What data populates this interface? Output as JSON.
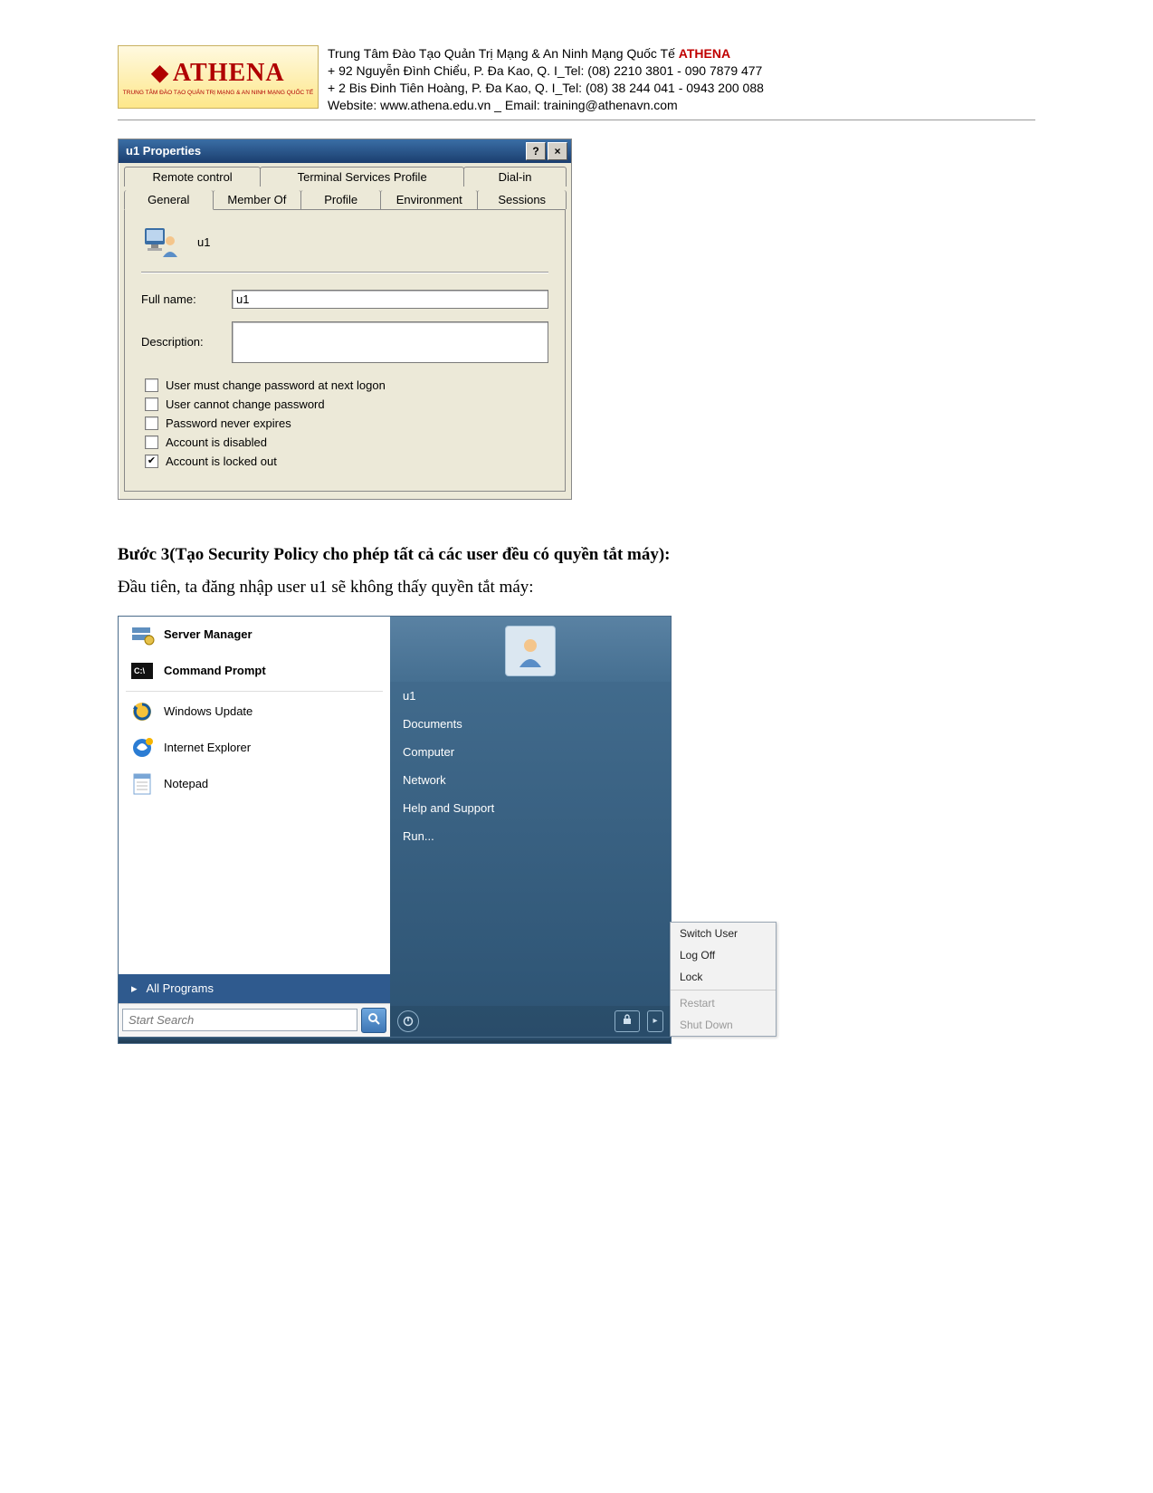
{
  "banner": {
    "logo_text": "ATHENA",
    "logo_sub": "TRUNG TÂM ĐÀO TẠO QUẢN TRỊ MẠNG & AN NINH MẠNG QUỐC TẾ",
    "line1_prefix": "Trung Tâm Đào Tạo Quản Trị Mạng & An Ninh Mạng Quốc Tế ",
    "line1_brand": "ATHENA",
    "line2": "+  92 Nguyễn Đình Chiểu, P. Đa Kao, Q. I_Tel: (08) 2210 3801 -  090 7879 477",
    "line3": "+  2 Bis Đinh Tiên Hoàng, P. Đa Kao, Q. I_Tel: (08) 38 244 041 - 0943 200 088",
    "line4": "Website:  www.athena.edu.vn     _      Email: training@athenavn.com"
  },
  "dialog": {
    "title": "u1 Properties",
    "help": "?",
    "close": "×",
    "tabs_row1": [
      "Remote control",
      "Terminal Services Profile",
      "Dial-in"
    ],
    "tabs_row2": [
      "General",
      "Member Of",
      "Profile",
      "Environment",
      "Sessions"
    ],
    "active_tab": "General",
    "username": "u1",
    "full_name_label": "Full name:",
    "full_name_value": "u1",
    "description_label": "Description:",
    "description_value": "",
    "checks": [
      {
        "label": "User must change password at next logon",
        "checked": false
      },
      {
        "label": "User cannot change password",
        "checked": false
      },
      {
        "label": "Password never expires",
        "checked": false
      },
      {
        "label": "Account is disabled",
        "checked": false
      },
      {
        "label": "Account is locked out",
        "checked": true
      }
    ]
  },
  "body": {
    "step_title": "Bước 3(Tạo Security Policy cho phép tất cả các user đều có quyền tắt máy):",
    "step_text": "Đầu tiên, ta đăng nhập user u1 sẽ không thấy quyền tắt máy:"
  },
  "startmenu": {
    "left_items": [
      {
        "label": "Server Manager",
        "bold": true,
        "icon": "server-icon"
      },
      {
        "label": "Command Prompt",
        "bold": true,
        "icon": "cmd-icon"
      },
      {
        "label": "Windows Update",
        "bold": false,
        "icon": "update-icon"
      },
      {
        "label": "Internet Explorer",
        "bold": false,
        "icon": "ie-icon"
      },
      {
        "label": "Notepad",
        "bold": false,
        "icon": "notepad-icon"
      }
    ],
    "all_programs": "All Programs",
    "search_placeholder": "Start Search",
    "right_user": "u1",
    "right_items": [
      "Documents",
      "Computer",
      "Network",
      "Help and Support",
      "Run..."
    ],
    "flyout": [
      {
        "label": "Switch User",
        "disabled": false
      },
      {
        "label": "Log Off",
        "disabled": false
      },
      {
        "label": "Lock",
        "disabled": false
      },
      {
        "label": "Restart",
        "disabled": true
      },
      {
        "label": "Shut Down",
        "disabled": true
      }
    ]
  }
}
